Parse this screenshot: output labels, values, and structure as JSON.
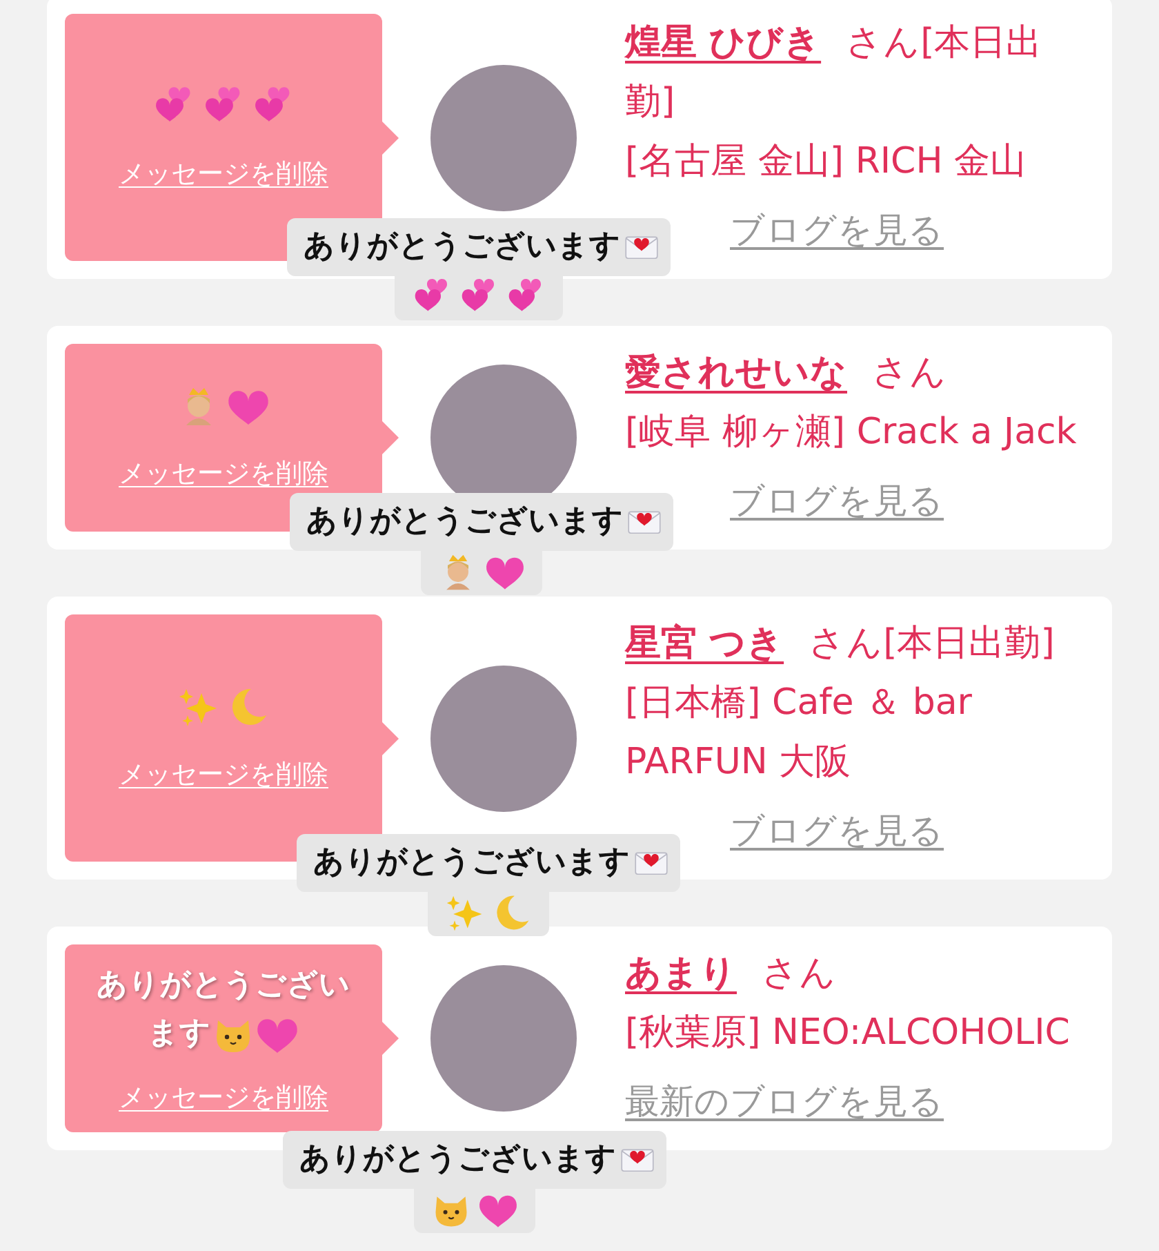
{
  "cards": [
    {
      "bubble": {
        "icons": [
          {
            "kind": "revolving-hearts"
          },
          {
            "kind": "revolving-hearts"
          },
          {
            "kind": "revolving-hearts"
          }
        ],
        "delete_link": "メッセージを削除"
      },
      "name": "煌星 ひびき",
      "honorific": "さん",
      "status": "[本日出勤]",
      "store": "[名古屋 金山] RICH 金山",
      "blog_link": "ブログを見る",
      "caption": {
        "text": "ありがとうございます",
        "end_icon": {
          "kind": "love-letter"
        },
        "icons": [
          {
            "kind": "revolving-hearts"
          },
          {
            "kind": "revolving-hearts"
          },
          {
            "kind": "revolving-hearts"
          }
        ]
      }
    },
    {
      "bubble": {
        "icons": [
          {
            "kind": "princess"
          },
          {
            "kind": "pink-heart"
          }
        ],
        "delete_link": "メッセージを削除"
      },
      "name": "愛されせいな",
      "honorific": "さん",
      "store": "[岐阜 柳ヶ瀬] Crack a Jack",
      "blog_link": "ブログを見る",
      "caption": {
        "text": "ありがとうございます",
        "end_icon": {
          "kind": "love-letter"
        },
        "icons": [
          {
            "kind": "princess"
          },
          {
            "kind": "pink-heart"
          }
        ]
      }
    },
    {
      "bubble": {
        "icons": [
          {
            "kind": "sparkles"
          },
          {
            "kind": "crescent-moon"
          }
        ],
        "delete_link": "メッセージを削除"
      },
      "name": "星宮 つき",
      "honorific": "さん",
      "status": "[本日出勤]",
      "store": "[日本橋] Cafe ＆ bar PARFUN 大阪",
      "blog_link": "ブログを見る",
      "caption": {
        "text": "ありがとうございます",
        "end_icon": {
          "kind": "love-letter"
        },
        "icons": [
          {
            "kind": "sparkles"
          },
          {
            "kind": "crescent-moon"
          }
        ]
      }
    },
    {
      "bubble": {
        "message": "ありがとうございます",
        "icons": [
          {
            "kind": "cat-face"
          },
          {
            "kind": "pink-heart"
          }
        ],
        "delete_link": "メッセージを削除"
      },
      "name": "あまり",
      "honorific": "さん",
      "store": "[秋葉原] NEO:ALCOHOLIC",
      "blog_link": "最新のブログを見る",
      "caption": {
        "text": "ありがとうございます",
        "end_icon": {
          "kind": "love-letter"
        },
        "icons": [
          {
            "kind": "cat-face"
          },
          {
            "kind": "pink-heart"
          }
        ]
      }
    }
  ]
}
